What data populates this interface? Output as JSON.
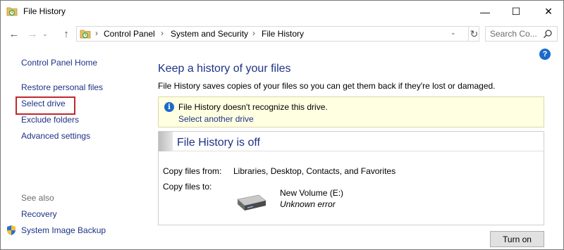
{
  "window": {
    "title": "File History",
    "icon": "file-history-icon",
    "controls": {
      "minimize": "—",
      "maximize": "☐",
      "close": "✕"
    }
  },
  "nav": {
    "back": "←",
    "forward": "→",
    "recent": "⌄",
    "up": "↑",
    "breadcrumbs": [
      "Control Panel",
      "System and Security",
      "File History"
    ],
    "separator": "›",
    "dropdown": "⌄",
    "refresh": "↻",
    "search_placeholder": "Search Co..."
  },
  "sidebar": {
    "home": "Control Panel Home",
    "items": [
      {
        "label": "Restore personal files"
      },
      {
        "label": "Select drive",
        "highlighted": true
      },
      {
        "label": "Exclude folders"
      },
      {
        "label": "Advanced settings"
      }
    ],
    "see_also_label": "See also",
    "see_also": [
      {
        "label": "Recovery"
      },
      {
        "label": "System Image Backup",
        "icon": "shield-icon"
      }
    ]
  },
  "main": {
    "help": "?",
    "heading": "Keep a history of your files",
    "description": "File History saves copies of your files so you can get them back if they're lost or damaged.",
    "info": {
      "icon": "i",
      "message": "File History doesn't recognize this drive.",
      "link": "Select another drive"
    },
    "status": {
      "title": "File History is off",
      "copy_from_label": "Copy files from:",
      "copy_from_value": "Libraries, Desktop, Contacts, and Favorites",
      "copy_to_label": "Copy files to:",
      "drive_name": "New Volume (E:)",
      "drive_status": "Unknown error"
    },
    "turn_on_button": "Turn on"
  },
  "colors": {
    "link": "#1e3287",
    "info_background": "#ffffe1",
    "highlight_border": "#c0282e",
    "accent": "#1b6ac9"
  }
}
